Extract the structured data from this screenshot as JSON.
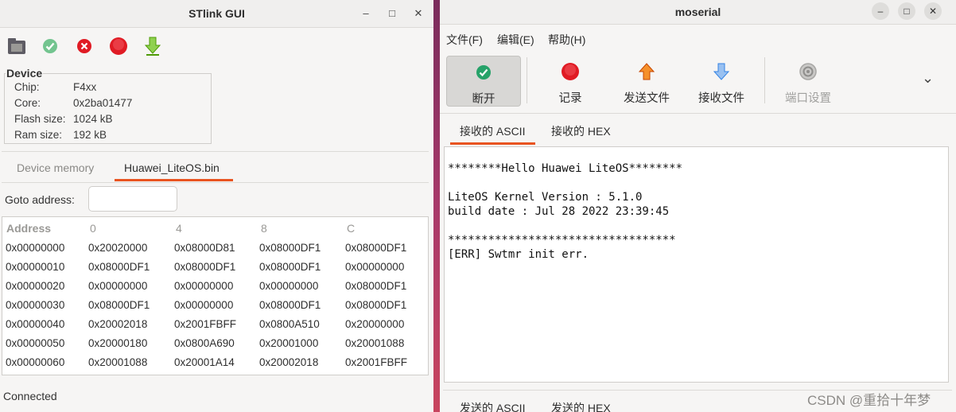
{
  "stlink": {
    "title": "STlink GUI",
    "window": {
      "minimize": "–",
      "maximize": "□",
      "close": "✕"
    },
    "toolbar": [
      "open-icon",
      "connect-icon",
      "disconnect-icon",
      "stop-icon",
      "download-icon"
    ],
    "device": {
      "legend": "Device",
      "rows": [
        {
          "label": "Chip:",
          "value": "F4xx"
        },
        {
          "label": "Core:",
          "value": "0x2ba01477"
        },
        {
          "label": "Flash size:",
          "value": "1024 kB"
        },
        {
          "label": "Ram size:",
          "value": "192 kB"
        }
      ]
    },
    "tabs": [
      "Device memory",
      "Huawei_LiteOS.bin"
    ],
    "active_tab": 1,
    "goto_label": "Goto address:",
    "goto_value": "",
    "memory": {
      "headers": [
        "Address",
        "0",
        "4",
        "8",
        "C"
      ],
      "rows": [
        [
          "0x00000000",
          "0x20020000",
          "0x08000D81",
          "0x08000DF1",
          "0x08000DF1"
        ],
        [
          "0x00000010",
          "0x08000DF1",
          "0x08000DF1",
          "0x08000DF1",
          "0x00000000"
        ],
        [
          "0x00000020",
          "0x00000000",
          "0x00000000",
          "0x00000000",
          "0x08000DF1"
        ],
        [
          "0x00000030",
          "0x08000DF1",
          "0x00000000",
          "0x08000DF1",
          "0x08000DF1"
        ],
        [
          "0x00000040",
          "0x20002018",
          "0x2001FBFF",
          "0x0800A510",
          "0x20000000"
        ],
        [
          "0x00000050",
          "0x20000180",
          "0x0800A690",
          "0x20001000",
          "0x20001088"
        ],
        [
          "0x00000060",
          "0x20001088",
          "0x20001A14",
          "0x20002018",
          "0x2001FBFF"
        ]
      ]
    },
    "status": "Connected",
    "colors": {
      "accent": "#e95420"
    }
  },
  "moserial": {
    "title": "moserial",
    "window": {
      "minimize": "–",
      "maximize": "□",
      "close": "✕"
    },
    "menu": [
      "文件(F)",
      "编辑(E)",
      "帮助(H)"
    ],
    "toolbar": [
      {
        "label": "断开",
        "icon": "connected-check-icon",
        "pressed": true
      },
      {
        "label": "记录",
        "icon": "record-icon"
      },
      {
        "label": "发送文件",
        "icon": "send-up-arrow-icon"
      },
      {
        "label": "接收文件",
        "icon": "receive-down-arrow-icon"
      },
      {
        "label": "端口设置",
        "icon": "port-settings-gear-icon",
        "disabled": true
      }
    ],
    "overflow": "⌄",
    "receive_tabs": [
      "接收的 ASCII",
      "接收的 HEX"
    ],
    "terminal_lines": [
      "********Hello Huawei LiteOS********",
      "",
      "LiteOS Kernel Version : 5.1.0",
      "build date : Jul 28 2022 23:39:45",
      "",
      "**********************************",
      "[ERR] Swtmr init err."
    ],
    "send_tabs": [
      "发送的 ASCII",
      "发送的 HEX"
    ]
  },
  "watermark": "CSDN @重拾十年梦"
}
